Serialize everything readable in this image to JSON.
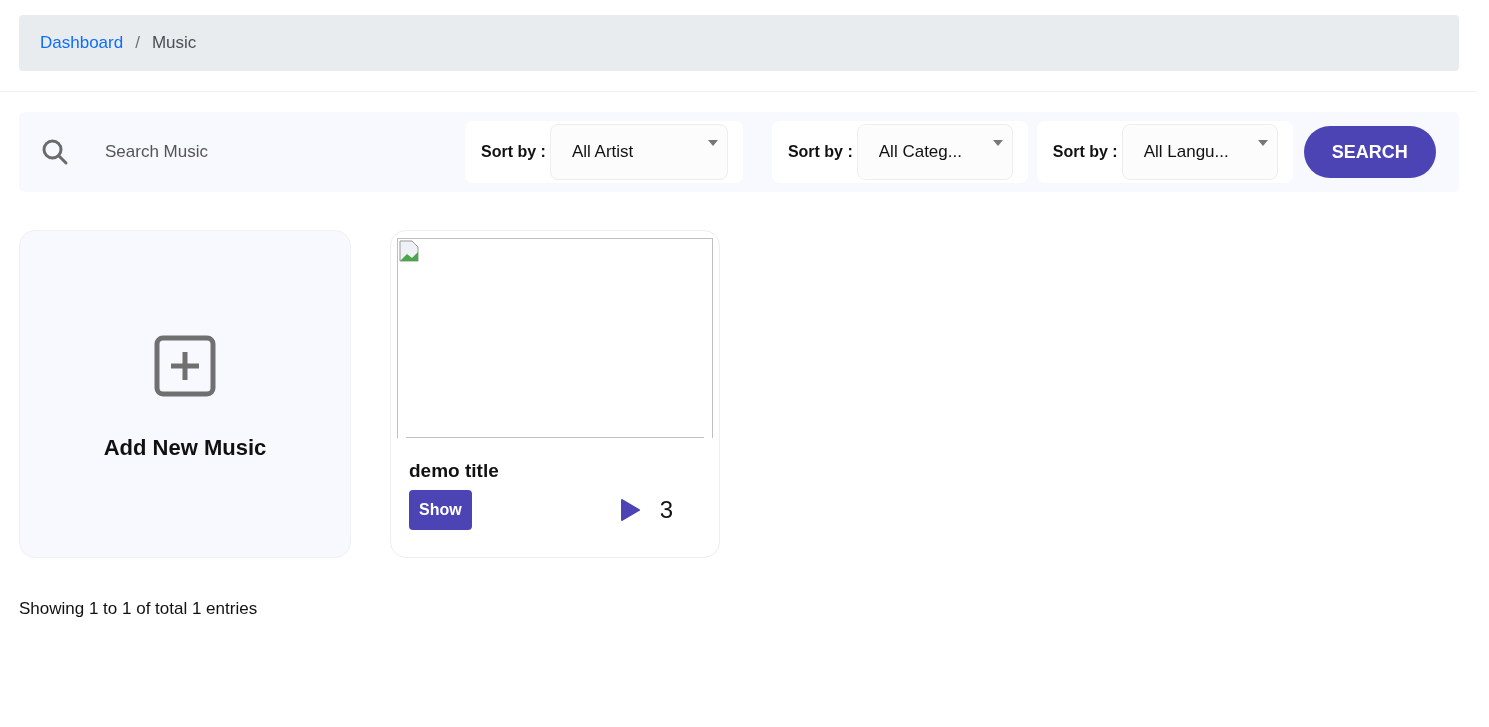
{
  "breadcrumb": [
    {
      "label": "Dashboard",
      "kind": "link"
    },
    {
      "label": "Music",
      "kind": "current"
    }
  ],
  "breadcrumb_separator": "/",
  "search": {
    "placeholder": "Search Music"
  },
  "filters": [
    {
      "label": "Sort by :",
      "value": "All Artist"
    },
    {
      "label": "Sort by :",
      "value": "All Categ..."
    },
    {
      "label": "Sort by :",
      "value": "All Langu..."
    }
  ],
  "search_button": "SEARCH",
  "add_card": {
    "label": "Add New Music"
  },
  "music": [
    {
      "title": "demo title",
      "button": "Show",
      "plays": "3"
    }
  ],
  "footer": "Showing 1 to 1 of total 1 entries"
}
